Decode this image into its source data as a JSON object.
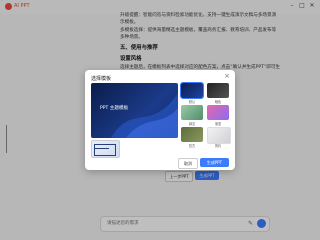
{
  "window": {
    "title": "AI PPT"
  },
  "document": {
    "paragraphs": [
      "升级提醒：智能问答与资料检索功能优化，支持一键生成演示文稿与多场景演示模板。",
      "多模板选择：提供海量精选主题模板，覆盖商务汇报、教育培训、产品发布等多种场景。"
    ],
    "heading": "五、使用与推荐",
    "subheading": "设置风格",
    "body": "选择主题后，在模板列表中选择对应的配色方案，点击“确认并生成PPT”即可生成，生成后可继续编辑。"
  },
  "dialog": {
    "title": "选择模板",
    "preview_title": "PPT 主题模板",
    "thumbnails": [
      {
        "label": "默认",
        "selected": true
      },
      {
        "label": "暗色"
      },
      {
        "label": "绿意"
      },
      {
        "label": "渐变"
      },
      {
        "label": "复古"
      },
      {
        "label": "简约"
      }
    ],
    "cancel_label": "取消",
    "confirm_label": "生成PPT"
  },
  "behind_buttons": {
    "left": "上一步PPT",
    "right": "生成PPT"
  },
  "input": {
    "placeholder": "请描述您的需求"
  },
  "colors": {
    "accent": "#3b7cff",
    "brand": "#e94b3c",
    "preview_dark": "#0a1c4a"
  }
}
